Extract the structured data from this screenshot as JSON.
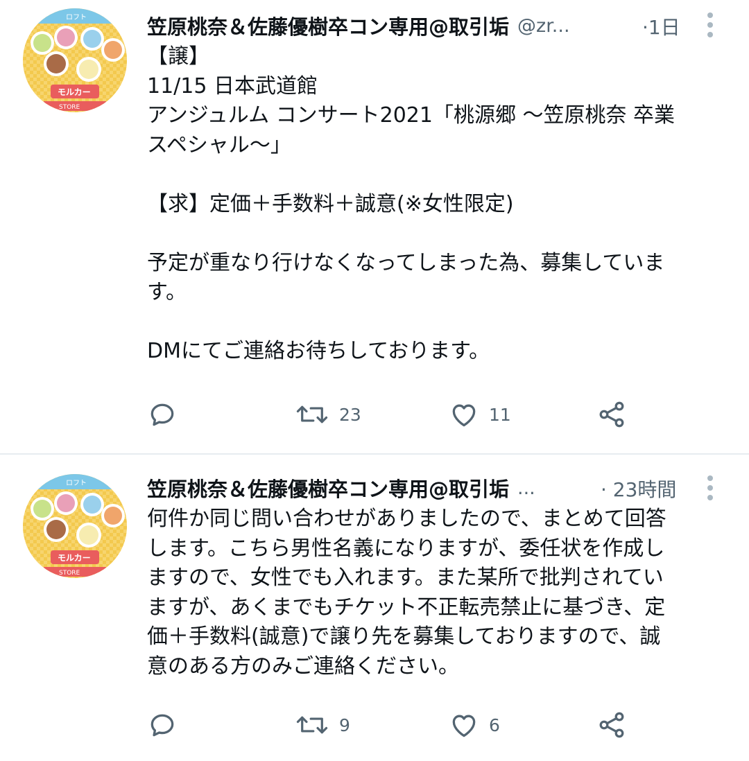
{
  "tweets": [
    {
      "display_name": "笠原桃奈＆佐藤優樹卒コン専用@取引垢",
      "handle": "@zr...",
      "time": "·1日",
      "body_lines": [
        "【譲】",
        "11/15 日本武道館",
        "アンジュルム コンサート2021「桃源郷 〜笠原桃奈 卒業",
        "スペシャル〜」",
        "",
        "【求】定価＋手数料＋誠意(※女性限定)",
        "",
        "予定が重なり行けなくなってしまった為、募集していま",
        "す。",
        "",
        "DMにてご連絡お待ちしております。"
      ],
      "retweets": "23",
      "likes": "11"
    },
    {
      "display_name": "笠原桃奈＆佐藤優樹卒コン専用@取引垢",
      "handle": "...",
      "time": "· 23時間",
      "body_lines": [
        "何件か同じ問い合わせがありましたので、まとめて回答",
        "します。こちら男性名義になりますが、委任状を作成し",
        "ますので、女性でも入れます。また某所で批判されてい",
        "ますが、あくまでもチケット不正転売禁止に基づき、定",
        "価＋手数料(誠意)で譲り先を募集しておりますので、誠",
        "意のある方のみご連絡ください。"
      ],
      "retweets": "9",
      "likes": "6"
    }
  ],
  "avatar": {
    "text_top": "ロフト",
    "text_logo": "モルカー",
    "text_bottom": "STORE"
  },
  "icons": [
    "reply-icon",
    "retweet-icon",
    "like-icon",
    "share-icon",
    "more-icon"
  ],
  "colors": {
    "text_primary": "#0f1419",
    "text_secondary": "#536471",
    "icon_gray": "#536471",
    "divider": "#e6ecf0"
  }
}
